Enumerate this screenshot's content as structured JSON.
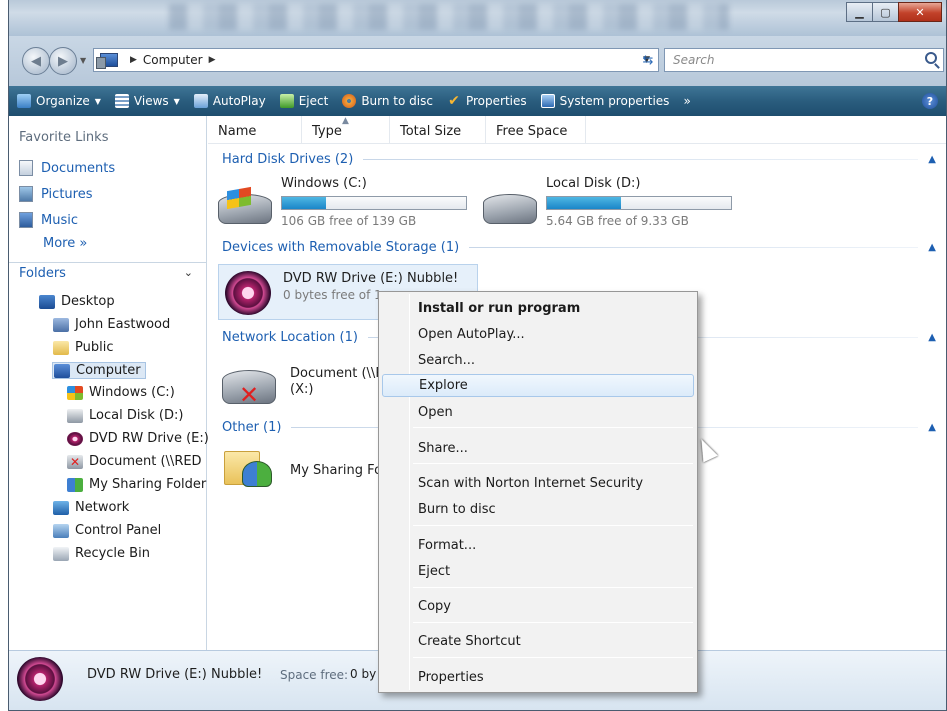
{
  "address": {
    "crumbs": [
      "Computer"
    ],
    "search_placeholder": "Search"
  },
  "toolbar": {
    "organize": "Organize",
    "views": "Views",
    "autoplay": "AutoPlay",
    "eject": "Eject",
    "burn": "Burn to disc",
    "properties": "Properties",
    "system_properties": "System properties",
    "overflow": "»"
  },
  "nav": {
    "favorite_title": "Favorite Links",
    "favorites": [
      "Documents",
      "Pictures",
      "Music"
    ],
    "more": "More »",
    "folders_label": "Folders",
    "tree": [
      "Desktop",
      "John Eastwood",
      "Public",
      "Computer",
      "Windows (C:)",
      "Local Disk (D:)",
      "DVD RW Drive (E:)",
      "Document (\\\\RED",
      "My Sharing Folder",
      "Network",
      "Control Panel",
      "Recycle Bin"
    ]
  },
  "columns": [
    "Name",
    "Type",
    "Total Size",
    "Free Space"
  ],
  "groups": {
    "hdd": "Hard Disk Drives (2)",
    "removable": "Devices with Removable Storage (1)",
    "network": "Network Location (1)",
    "other": "Other (1)"
  },
  "drives": [
    {
      "name": "Windows (C:)",
      "free": "106 GB free of 139 GB",
      "used_fraction": 0.24
    },
    {
      "name": "Local Disk (D:)",
      "free": "5.64 GB free of 9.33 GB",
      "used_fraction": 0.4
    }
  ],
  "dvd": {
    "name": "DVD RW Drive (E:) Nubble!",
    "free": "0 bytes free of 1"
  },
  "network_item": {
    "line1": "Document (\\\\R",
    "line2": "(X:)"
  },
  "other_item": "My Sharing Fol",
  "details": {
    "name": "DVD RW Drive (E:) Nubble!",
    "label": "Space free:",
    "value": "0 by"
  },
  "context_menu": [
    "Install or run program",
    "Open AutoPlay...",
    "Search...",
    "Explore",
    "Open",
    "Share...",
    "Scan with Norton Internet Security",
    "Burn to disc",
    "Format...",
    "Eject",
    "Copy",
    "Create Shortcut",
    "Properties"
  ],
  "colors": {
    "cmdbar": "#2a5d7e",
    "link": "#1d5fb1",
    "progress": "#1b86c8",
    "close_button": "#c2422a"
  }
}
